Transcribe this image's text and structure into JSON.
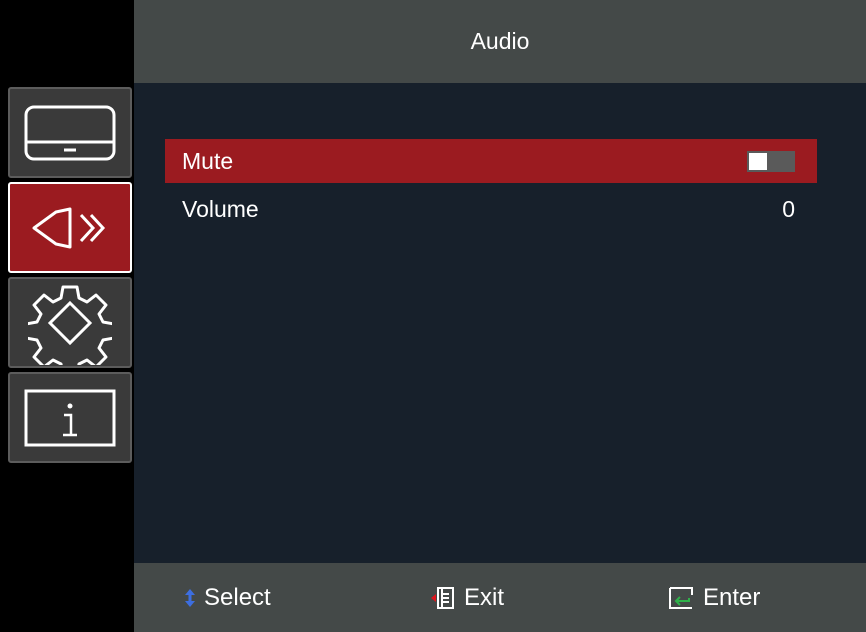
{
  "header": {
    "title": "Audio"
  },
  "sidebar": {
    "tabs": [
      {
        "name": "display",
        "icon": "display-icon"
      },
      {
        "name": "audio",
        "icon": "speaker-icon",
        "active": true
      },
      {
        "name": "settings",
        "icon": "gear-icon"
      },
      {
        "name": "information",
        "icon": "info-icon"
      }
    ]
  },
  "menu": {
    "items": [
      {
        "label": "Mute",
        "control": "toggle",
        "state": "off"
      },
      {
        "label": "Volume",
        "value": "0"
      }
    ]
  },
  "footer": {
    "select_label": "Select",
    "exit_label": "Exit",
    "enter_label": "Enter"
  },
  "colors": {
    "accent": "#9b1b20",
    "header_bg": "#444948",
    "main_bg": "#17202b"
  }
}
